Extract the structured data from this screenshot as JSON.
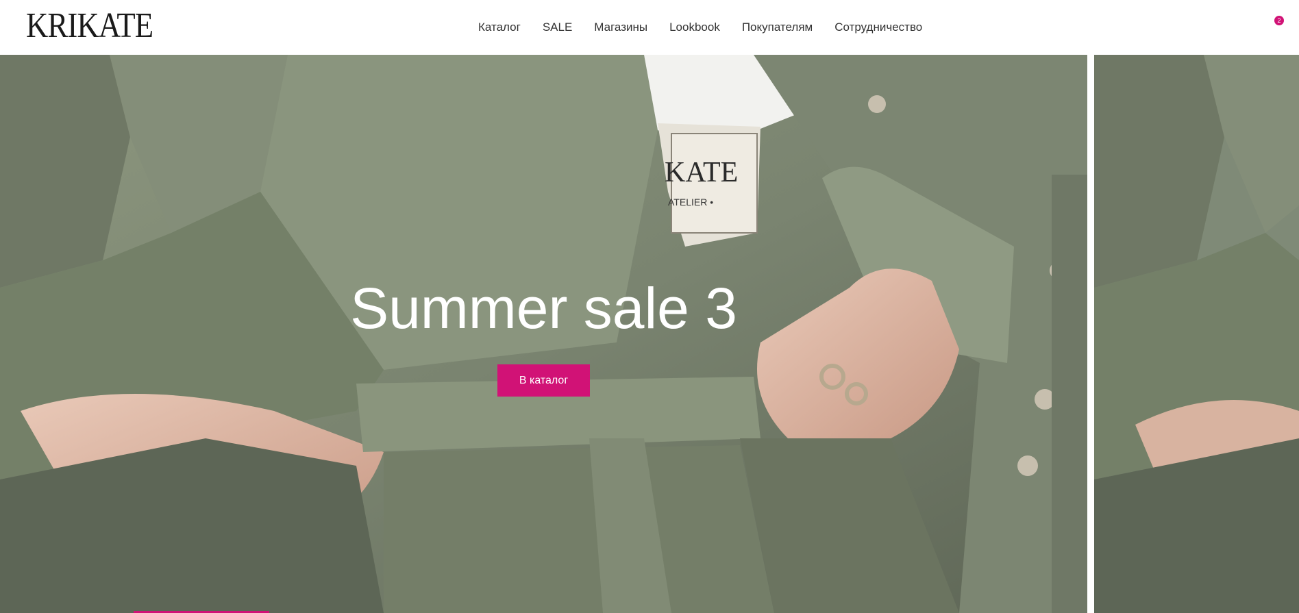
{
  "header": {
    "logo": "KRIKATE",
    "nav": [
      "Каталог",
      "SALE",
      "Магазины",
      "Lookbook",
      "Покупателям",
      "Сотрудничество"
    ],
    "cart_count": "2"
  },
  "hero": {
    "title": "Summer sale 3",
    "button_label": "В каталог",
    "label_brand": "KATE",
    "label_sub": "ATELIER •"
  },
  "colors": {
    "accent": "#d11276",
    "linen_green": "#7f8a77"
  }
}
